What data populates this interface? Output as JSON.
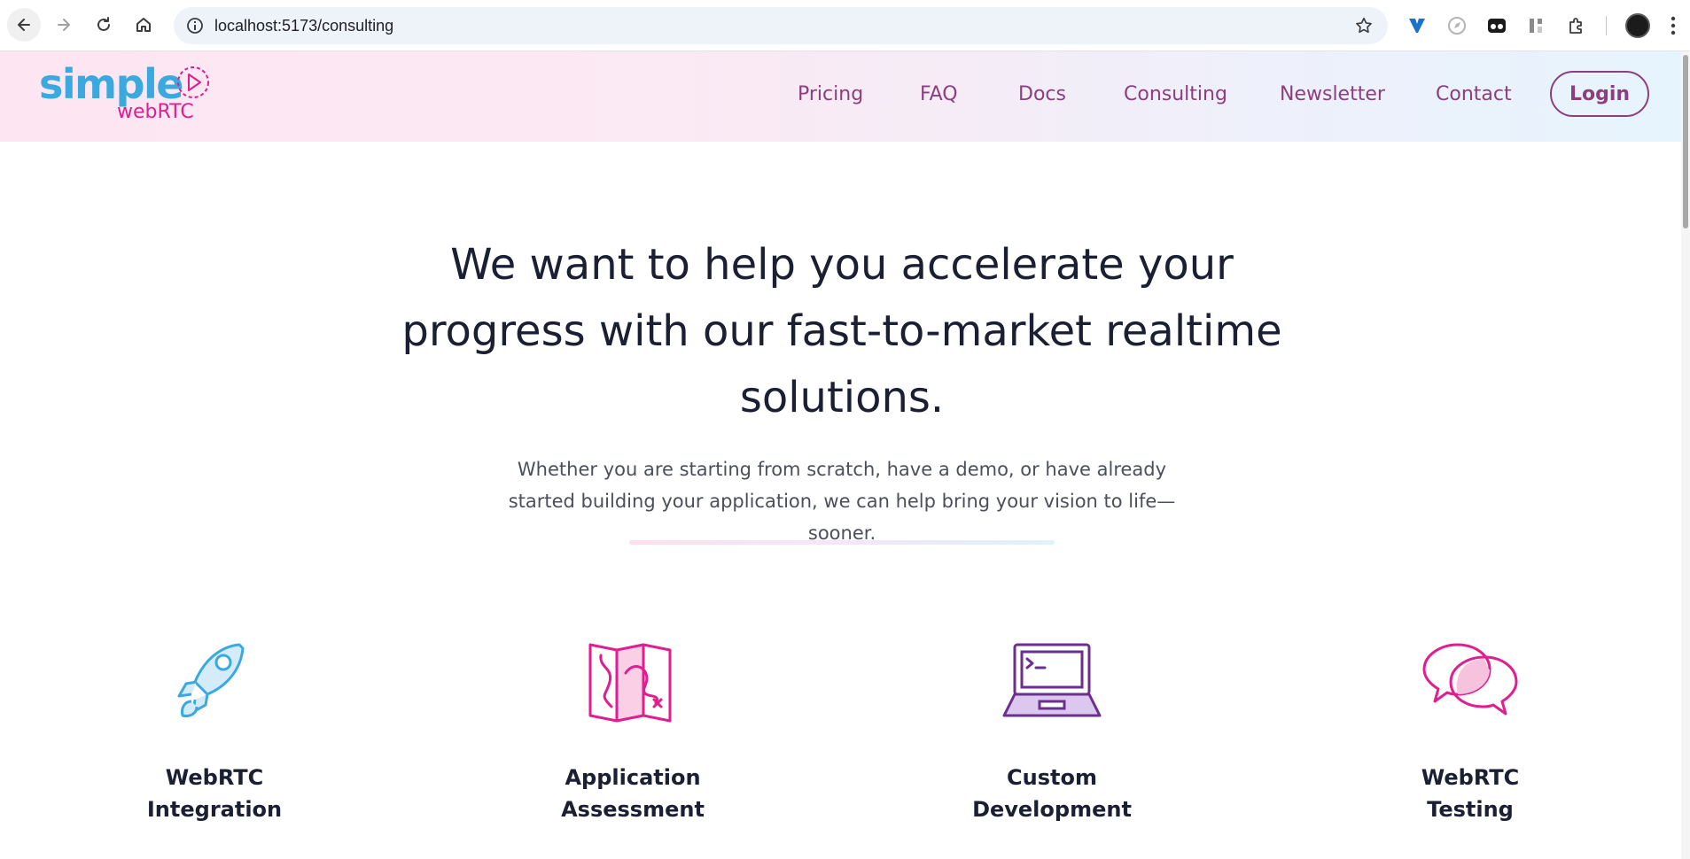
{
  "browser": {
    "url": "localhost:5173/consulting",
    "icons": {
      "back": "arrow-left-icon",
      "forward": "arrow-right-icon",
      "reload": "reload-icon",
      "home": "home-icon",
      "site_info": "info-icon",
      "bookmark": "star-icon",
      "extensions": [
        "vectorworks-extension-icon",
        "compass-extension-icon",
        "dark-mode-extension-icon",
        "todo-extension-icon",
        "puzzle-extensions-icon"
      ],
      "profile": "profile-avatar",
      "menu": "kebab-menu-icon"
    }
  },
  "site": {
    "logo": {
      "primary": "simple",
      "secondary": "webRTC"
    },
    "nav": [
      "Pricing",
      "FAQ",
      "Docs",
      "Consulting",
      "Newsletter",
      "Contact"
    ],
    "login_label": "Login",
    "colors": {
      "nav_text": "#8b3f7e",
      "logo_blue": "#3aa9e0",
      "logo_pink": "#e01e8f",
      "purple": "#6b2f8f"
    }
  },
  "hero": {
    "title": "We want to help you accelerate your progress with our fast-to-market realtime solutions.",
    "subtitle": "Whether you are starting from scratch, have a demo, or have already started building your application, we can help bring your vision to life—sooner."
  },
  "services": [
    {
      "label": "WebRTC\nIntegration",
      "icon": "rocket-icon"
    },
    {
      "label": "Application\nAssessment",
      "icon": "map-icon"
    },
    {
      "label": "Custom\nDevelopment",
      "icon": "laptop-terminal-icon"
    },
    {
      "label": "WebRTC\nTesting",
      "icon": "chat-bubbles-icon"
    }
  ]
}
